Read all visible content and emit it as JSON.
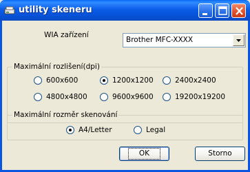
{
  "window": {
    "title": "utility skeneru",
    "icon": "scanner-utility-icon",
    "controls": {
      "minimize_icon": "minimize-icon",
      "maximize_icon": "maximize-icon",
      "close_icon": "close-icon"
    }
  },
  "wia": {
    "label": "WIA zařízení",
    "device_value": "Brother MFC-XXXX"
  },
  "resolution": {
    "group_title": "Maximální rozlišení(dpi)",
    "options": [
      "600x600",
      "1200x1200",
      "2400x2400",
      "4800x4800",
      "9600x9600",
      "19200x19200"
    ],
    "selected": "1200x1200"
  },
  "scan_size": {
    "group_title": "Maximální rozměr skenování",
    "options": [
      "A4/Letter",
      "Legal"
    ],
    "selected": "A4/Letter"
  },
  "buttons": {
    "ok": "OK",
    "cancel": "Storno"
  },
  "colors": {
    "titlebar": "#0a5ee8",
    "dialog_bg": "#ece9d8",
    "close_button": "#e0502a"
  }
}
